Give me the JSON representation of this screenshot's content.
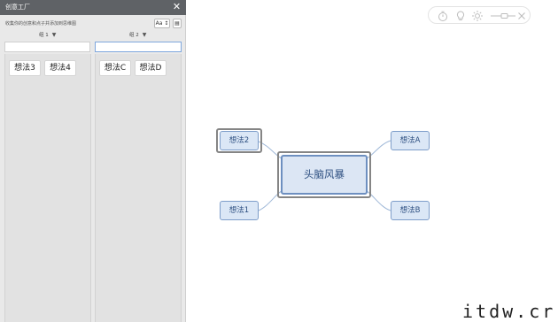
{
  "panel": {
    "title": "创意工厂",
    "close_glyph": "✕",
    "hint": "收集你的创意和点子并添加到思维图",
    "font_button": "Aa ↕",
    "list_button": "▤",
    "groups": [
      {
        "label": "组 1",
        "caret": "▼",
        "ideas": [
          "想法3",
          "想法4"
        ]
      },
      {
        "label": "组 2",
        "caret": "▼",
        "ideas": [
          "想法C",
          "想法D"
        ]
      }
    ]
  },
  "toolbar": {
    "icons": [
      "timer-icon",
      "lightbulb-icon",
      "brightness-icon",
      "zoom-slider",
      "close-icon"
    ]
  },
  "mindmap": {
    "central": "头脑风暴",
    "left_top": "想法2",
    "left_bottom": "想法1",
    "right_top": "想法A",
    "right_bottom": "想法B"
  },
  "watermark": "itdw.cr",
  "colors": {
    "node_fill": "#dbe7f6",
    "node_border": "#7d9dc9",
    "connector": "#9fb8d8",
    "panel_header": "#5f6266"
  }
}
